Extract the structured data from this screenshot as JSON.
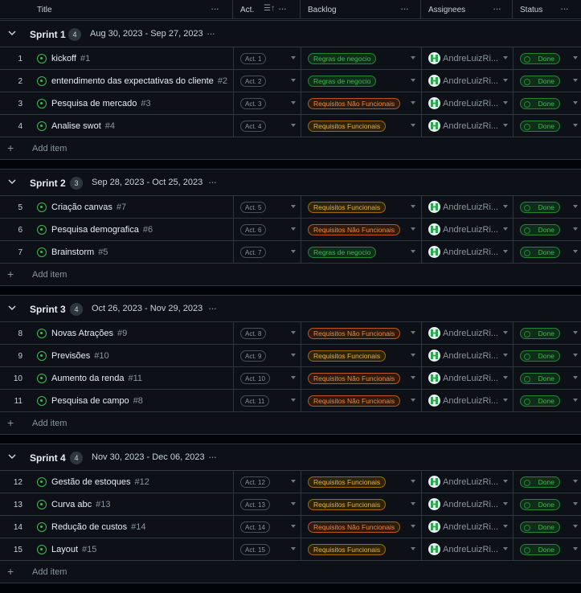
{
  "header": {
    "title": "Title",
    "act": "Act.",
    "backlog": "Backlog",
    "assignees": "Assignees",
    "status": "Status",
    "sort_icon": "sort-ascending-icon",
    "more_icon": "more-horizontal-icon"
  },
  "colors": {
    "green": "#3fb950",
    "yellow": "#e3b341",
    "orange": "#f0883e",
    "background": "#0d1117"
  },
  "add_item_label": "Add item",
  "groups": [
    {
      "name": "Sprint 1",
      "count": "4",
      "dates": "Aug 30, 2023 - Sep 27, 2023",
      "rows": [
        {
          "num": "1",
          "title": "kickoff",
          "issue": "#1",
          "act": "Act. 1",
          "backlog": "Regras de negocio",
          "backlog_color": "green",
          "assignee": "AndreLuizRi...",
          "status": "Done"
        },
        {
          "num": "2",
          "title": "entendimento das expectativas do cliente",
          "issue": "#2",
          "act": "Act. 2",
          "backlog": "Regras de negocio",
          "backlog_color": "green",
          "assignee": "AndreLuizRi...",
          "status": "Done"
        },
        {
          "num": "3",
          "title": "Pesquisa de mercado",
          "issue": "#3",
          "act": "Act. 3",
          "backlog": "Requisitos Não Funcionais",
          "backlog_color": "orange",
          "assignee": "AndreLuizRi...",
          "status": "Done"
        },
        {
          "num": "4",
          "title": "Analise swot",
          "issue": "#4",
          "act": "Act. 4",
          "backlog": "Requisitos Funcionais",
          "backlog_color": "yellow",
          "assignee": "AndreLuizRi...",
          "status": "Done"
        }
      ]
    },
    {
      "name": "Sprint 2",
      "count": "3",
      "dates": "Sep 28, 2023 - Oct 25, 2023",
      "rows": [
        {
          "num": "5",
          "title": "Criação canvas",
          "issue": "#7",
          "act": "Act. 5",
          "backlog": "Requisitos Funcionais",
          "backlog_color": "yellow",
          "assignee": "AndreLuizRi...",
          "status": "Done"
        },
        {
          "num": "6",
          "title": "Pesquisa demografica",
          "issue": "#6",
          "act": "Act. 6",
          "backlog": "Requisitos Não Funcionais",
          "backlog_color": "orange",
          "assignee": "AndreLuizRi...",
          "status": "Done"
        },
        {
          "num": "7",
          "title": "Brainstorm",
          "issue": "#5",
          "act": "Act. 7",
          "backlog": "Regras de negocio",
          "backlog_color": "green",
          "assignee": "AndreLuizRi...",
          "status": "Done"
        }
      ]
    },
    {
      "name": "Sprint 3",
      "count": "4",
      "dates": "Oct 26, 2023 - Nov 29, 2023",
      "rows": [
        {
          "num": "8",
          "title": "Novas Atrações",
          "issue": "#9",
          "act": "Act. 8",
          "backlog": "Requisitos Não Funcionais",
          "backlog_color": "orange",
          "assignee": "AndreLuizRi...",
          "status": "Done"
        },
        {
          "num": "9",
          "title": "Previsões",
          "issue": "#10",
          "act": "Act. 9",
          "backlog": "Requisitos Funcionais",
          "backlog_color": "yellow",
          "assignee": "AndreLuizRi...",
          "status": "Done"
        },
        {
          "num": "10",
          "title": "Aumento da renda",
          "issue": "#11",
          "act": "Act. 10",
          "backlog": "Requisitos Não Funcionais",
          "backlog_color": "orange",
          "assignee": "AndreLuizRi...",
          "status": "Done"
        },
        {
          "num": "11",
          "title": "Pesquisa de campo",
          "issue": "#8",
          "act": "Act. 11",
          "backlog": "Requisitos Não Funcionais",
          "backlog_color": "orange",
          "assignee": "AndreLuizRi...",
          "status": "Done"
        }
      ]
    },
    {
      "name": "Sprint 4",
      "count": "4",
      "dates": "Nov 30, 2023 - Dec 06, 2023",
      "rows": [
        {
          "num": "12",
          "title": "Gestão de estoques",
          "issue": "#12",
          "act": "Act. 12",
          "backlog": "Requisitos Funcionais",
          "backlog_color": "yellow",
          "assignee": "AndreLuizRi...",
          "status": "Done"
        },
        {
          "num": "13",
          "title": "Curva abc",
          "issue": "#13",
          "act": "Act. 13",
          "backlog": "Requisitos Funcionais",
          "backlog_color": "yellow",
          "assignee": "AndreLuizRi...",
          "status": "Done"
        },
        {
          "num": "14",
          "title": "Redução de custos",
          "issue": "#14",
          "act": "Act. 14",
          "backlog": "Requisitos Não Funcionais",
          "backlog_color": "orange",
          "assignee": "AndreLuizRi...",
          "status": "Done"
        },
        {
          "num": "15",
          "title": "Layout",
          "issue": "#15",
          "act": "Act. 15",
          "backlog": "Requisitos Funcionais",
          "backlog_color": "yellow",
          "assignee": "AndreLuizRi...",
          "status": "Done"
        }
      ]
    }
  ]
}
